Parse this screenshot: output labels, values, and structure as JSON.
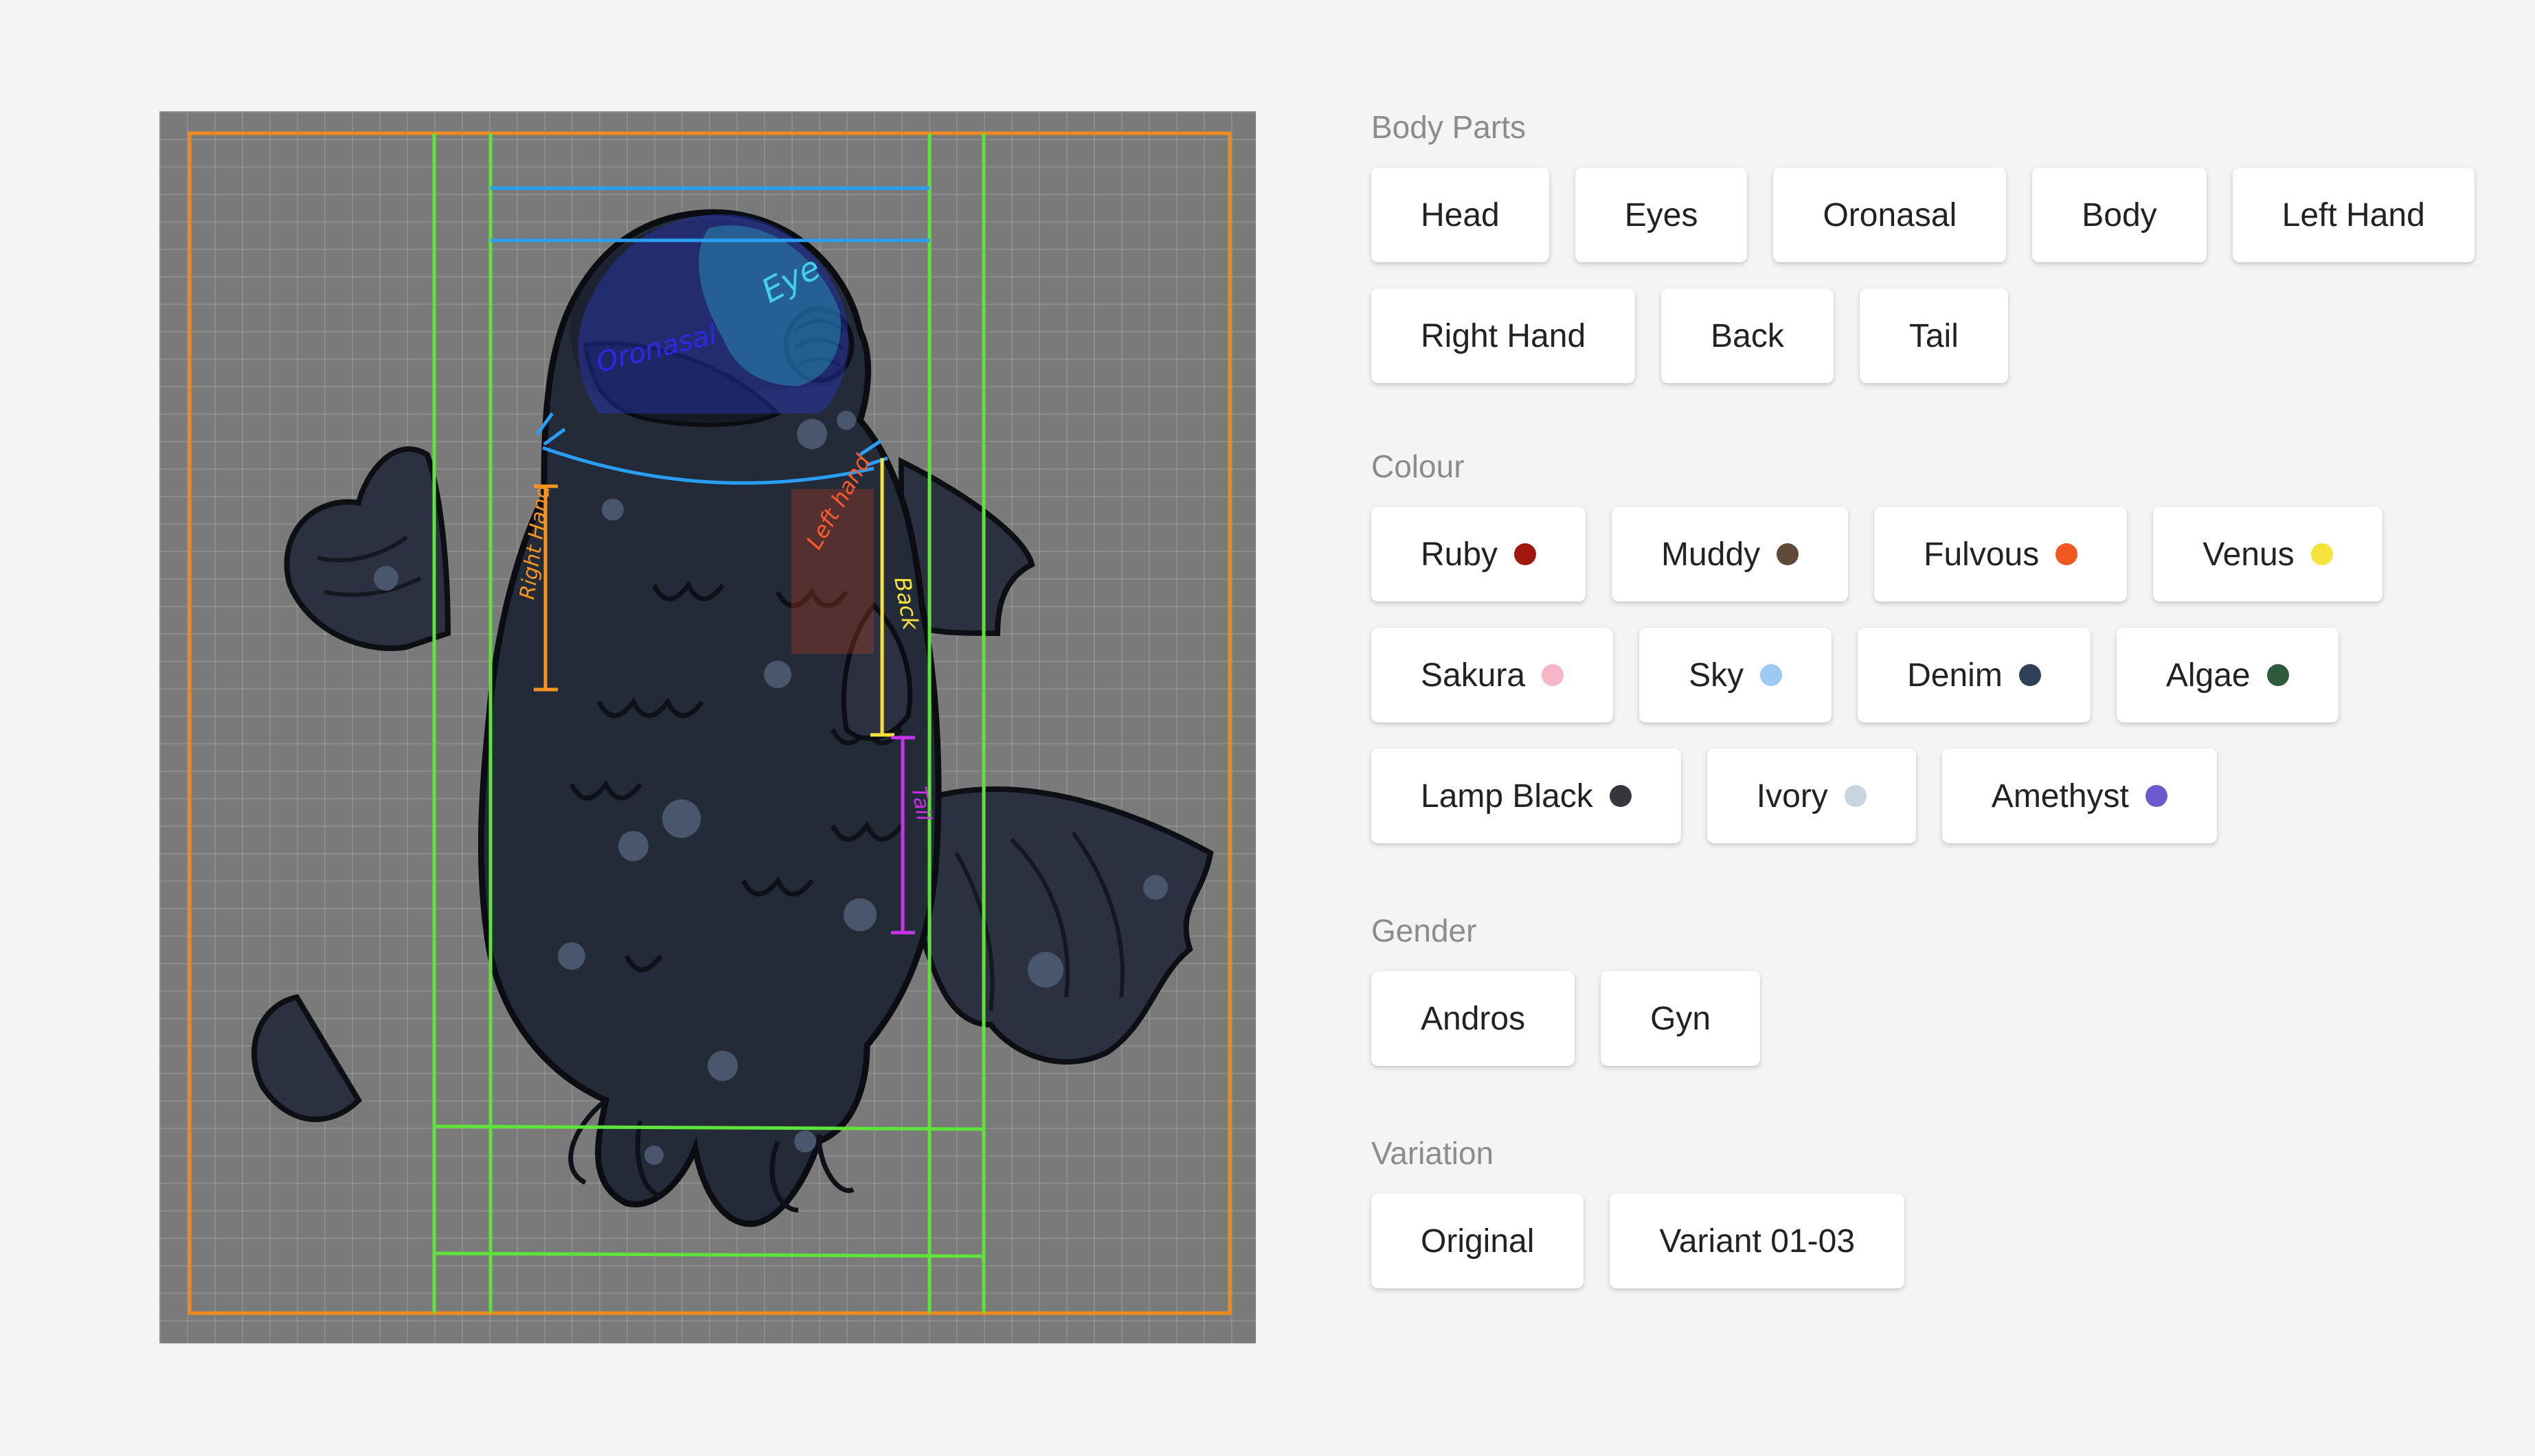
{
  "sections": {
    "body_parts": {
      "title": "Body Parts",
      "items": [
        {
          "label": "Head"
        },
        {
          "label": "Eyes"
        },
        {
          "label": "Oronasal"
        },
        {
          "label": "Body"
        },
        {
          "label": "Left Hand"
        },
        {
          "label": "Right Hand"
        },
        {
          "label": "Back"
        },
        {
          "label": "Tail"
        }
      ]
    },
    "colour": {
      "title": "Colour",
      "items": [
        {
          "label": "Ruby",
          "color": "#a0180e"
        },
        {
          "label": "Muddy",
          "color": "#5e4a36"
        },
        {
          "label": "Fulvous",
          "color": "#f05a22"
        },
        {
          "label": "Venus",
          "color": "#f5e23a"
        },
        {
          "label": "Sakura",
          "color": "#f7b6c8"
        },
        {
          "label": "Sky",
          "color": "#9ccaf5"
        },
        {
          "label": "Denim",
          "color": "#2e4057"
        },
        {
          "label": "Algae",
          "color": "#2f5a3a"
        },
        {
          "label": "Lamp Black",
          "color": "#35373d"
        },
        {
          "label": "Ivory",
          "color": "#c9d4de"
        },
        {
          "label": "Amethyst",
          "color": "#6a5acd"
        }
      ]
    },
    "gender": {
      "title": "Gender",
      "items": [
        {
          "label": "Andros"
        },
        {
          "label": "Gyn"
        }
      ]
    },
    "variation": {
      "title": "Variation",
      "items": [
        {
          "label": "Original"
        },
        {
          "label": "Variant 01-03"
        }
      ]
    }
  },
  "canvas": {
    "annotations": {
      "eye": "Eye",
      "oronasal": "Oronasal",
      "right_hand": "Right Hand",
      "left_hand": "Left hand",
      "back": "Back",
      "tail": "Tail"
    },
    "guide_colors": {
      "outer": "#f08a1c",
      "green": "#5ee33a",
      "blue": "#2a9df4",
      "right_hand": "#f7941d",
      "back": "#f5e23a",
      "tail": "#c832e6",
      "left_hand": "#ff5a2a",
      "oronasal": "#2a2ae6",
      "eye": "#43d0e6"
    }
  }
}
